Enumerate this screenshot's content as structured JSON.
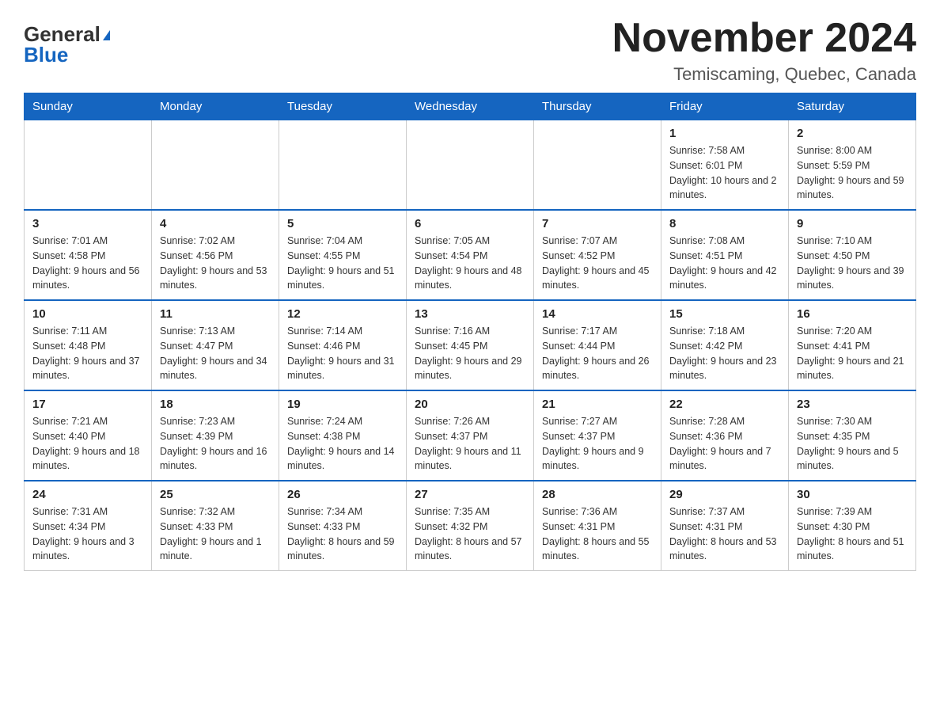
{
  "header": {
    "logo_general": "General",
    "logo_blue": "Blue",
    "month_title": "November 2024",
    "location": "Temiscaming, Quebec, Canada"
  },
  "weekdays": [
    "Sunday",
    "Monday",
    "Tuesday",
    "Wednesday",
    "Thursday",
    "Friday",
    "Saturday"
  ],
  "weeks": [
    [
      {
        "day": "",
        "sunrise": "",
        "sunset": "",
        "daylight": ""
      },
      {
        "day": "",
        "sunrise": "",
        "sunset": "",
        "daylight": ""
      },
      {
        "day": "",
        "sunrise": "",
        "sunset": "",
        "daylight": ""
      },
      {
        "day": "",
        "sunrise": "",
        "sunset": "",
        "daylight": ""
      },
      {
        "day": "",
        "sunrise": "",
        "sunset": "",
        "daylight": ""
      },
      {
        "day": "1",
        "sunrise": "Sunrise: 7:58 AM",
        "sunset": "Sunset: 6:01 PM",
        "daylight": "Daylight: 10 hours and 2 minutes."
      },
      {
        "day": "2",
        "sunrise": "Sunrise: 8:00 AM",
        "sunset": "Sunset: 5:59 PM",
        "daylight": "Daylight: 9 hours and 59 minutes."
      }
    ],
    [
      {
        "day": "3",
        "sunrise": "Sunrise: 7:01 AM",
        "sunset": "Sunset: 4:58 PM",
        "daylight": "Daylight: 9 hours and 56 minutes."
      },
      {
        "day": "4",
        "sunrise": "Sunrise: 7:02 AM",
        "sunset": "Sunset: 4:56 PM",
        "daylight": "Daylight: 9 hours and 53 minutes."
      },
      {
        "day": "5",
        "sunrise": "Sunrise: 7:04 AM",
        "sunset": "Sunset: 4:55 PM",
        "daylight": "Daylight: 9 hours and 51 minutes."
      },
      {
        "day": "6",
        "sunrise": "Sunrise: 7:05 AM",
        "sunset": "Sunset: 4:54 PM",
        "daylight": "Daylight: 9 hours and 48 minutes."
      },
      {
        "day": "7",
        "sunrise": "Sunrise: 7:07 AM",
        "sunset": "Sunset: 4:52 PM",
        "daylight": "Daylight: 9 hours and 45 minutes."
      },
      {
        "day": "8",
        "sunrise": "Sunrise: 7:08 AM",
        "sunset": "Sunset: 4:51 PM",
        "daylight": "Daylight: 9 hours and 42 minutes."
      },
      {
        "day": "9",
        "sunrise": "Sunrise: 7:10 AM",
        "sunset": "Sunset: 4:50 PM",
        "daylight": "Daylight: 9 hours and 39 minutes."
      }
    ],
    [
      {
        "day": "10",
        "sunrise": "Sunrise: 7:11 AM",
        "sunset": "Sunset: 4:48 PM",
        "daylight": "Daylight: 9 hours and 37 minutes."
      },
      {
        "day": "11",
        "sunrise": "Sunrise: 7:13 AM",
        "sunset": "Sunset: 4:47 PM",
        "daylight": "Daylight: 9 hours and 34 minutes."
      },
      {
        "day": "12",
        "sunrise": "Sunrise: 7:14 AM",
        "sunset": "Sunset: 4:46 PM",
        "daylight": "Daylight: 9 hours and 31 minutes."
      },
      {
        "day": "13",
        "sunrise": "Sunrise: 7:16 AM",
        "sunset": "Sunset: 4:45 PM",
        "daylight": "Daylight: 9 hours and 29 minutes."
      },
      {
        "day": "14",
        "sunrise": "Sunrise: 7:17 AM",
        "sunset": "Sunset: 4:44 PM",
        "daylight": "Daylight: 9 hours and 26 minutes."
      },
      {
        "day": "15",
        "sunrise": "Sunrise: 7:18 AM",
        "sunset": "Sunset: 4:42 PM",
        "daylight": "Daylight: 9 hours and 23 minutes."
      },
      {
        "day": "16",
        "sunrise": "Sunrise: 7:20 AM",
        "sunset": "Sunset: 4:41 PM",
        "daylight": "Daylight: 9 hours and 21 minutes."
      }
    ],
    [
      {
        "day": "17",
        "sunrise": "Sunrise: 7:21 AM",
        "sunset": "Sunset: 4:40 PM",
        "daylight": "Daylight: 9 hours and 18 minutes."
      },
      {
        "day": "18",
        "sunrise": "Sunrise: 7:23 AM",
        "sunset": "Sunset: 4:39 PM",
        "daylight": "Daylight: 9 hours and 16 minutes."
      },
      {
        "day": "19",
        "sunrise": "Sunrise: 7:24 AM",
        "sunset": "Sunset: 4:38 PM",
        "daylight": "Daylight: 9 hours and 14 minutes."
      },
      {
        "day": "20",
        "sunrise": "Sunrise: 7:26 AM",
        "sunset": "Sunset: 4:37 PM",
        "daylight": "Daylight: 9 hours and 11 minutes."
      },
      {
        "day": "21",
        "sunrise": "Sunrise: 7:27 AM",
        "sunset": "Sunset: 4:37 PM",
        "daylight": "Daylight: 9 hours and 9 minutes."
      },
      {
        "day": "22",
        "sunrise": "Sunrise: 7:28 AM",
        "sunset": "Sunset: 4:36 PM",
        "daylight": "Daylight: 9 hours and 7 minutes."
      },
      {
        "day": "23",
        "sunrise": "Sunrise: 7:30 AM",
        "sunset": "Sunset: 4:35 PM",
        "daylight": "Daylight: 9 hours and 5 minutes."
      }
    ],
    [
      {
        "day": "24",
        "sunrise": "Sunrise: 7:31 AM",
        "sunset": "Sunset: 4:34 PM",
        "daylight": "Daylight: 9 hours and 3 minutes."
      },
      {
        "day": "25",
        "sunrise": "Sunrise: 7:32 AM",
        "sunset": "Sunset: 4:33 PM",
        "daylight": "Daylight: 9 hours and 1 minute."
      },
      {
        "day": "26",
        "sunrise": "Sunrise: 7:34 AM",
        "sunset": "Sunset: 4:33 PM",
        "daylight": "Daylight: 8 hours and 59 minutes."
      },
      {
        "day": "27",
        "sunrise": "Sunrise: 7:35 AM",
        "sunset": "Sunset: 4:32 PM",
        "daylight": "Daylight: 8 hours and 57 minutes."
      },
      {
        "day": "28",
        "sunrise": "Sunrise: 7:36 AM",
        "sunset": "Sunset: 4:31 PM",
        "daylight": "Daylight: 8 hours and 55 minutes."
      },
      {
        "day": "29",
        "sunrise": "Sunrise: 7:37 AM",
        "sunset": "Sunset: 4:31 PM",
        "daylight": "Daylight: 8 hours and 53 minutes."
      },
      {
        "day": "30",
        "sunrise": "Sunrise: 7:39 AM",
        "sunset": "Sunset: 4:30 PM",
        "daylight": "Daylight: 8 hours and 51 minutes."
      }
    ]
  ]
}
